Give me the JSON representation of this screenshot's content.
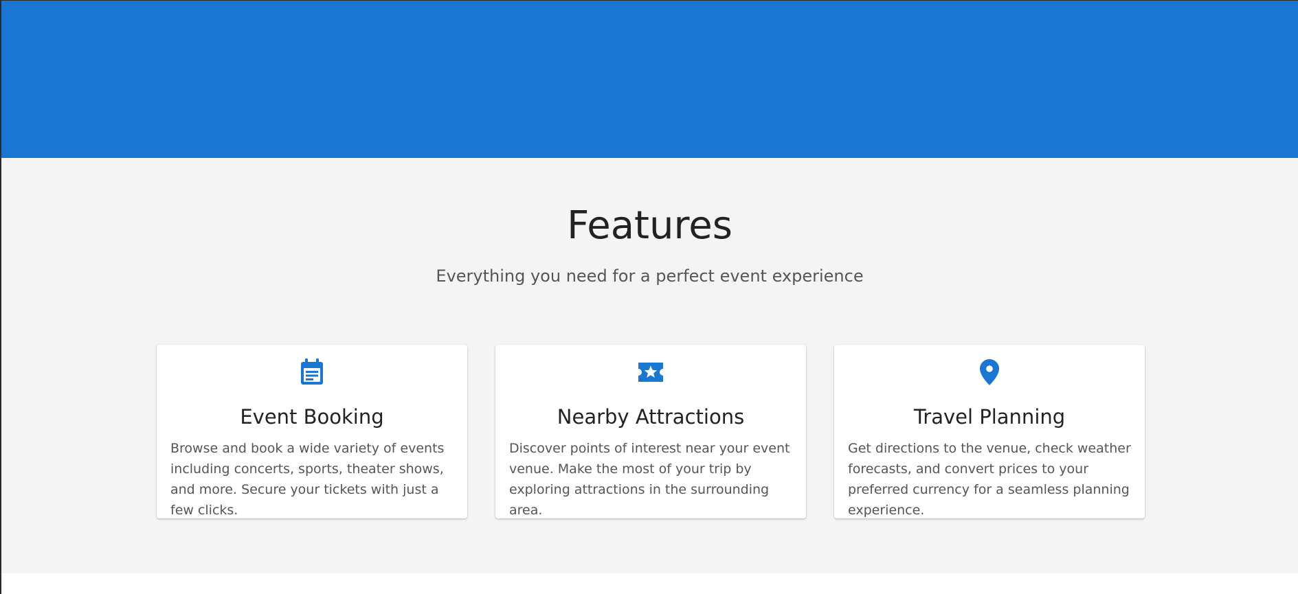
{
  "theme": {
    "primary_color": "#1976d2",
    "section_background": "#f4f4f4"
  },
  "features": {
    "title": "Features",
    "subtitle": "Everything you need for a perfect event experience",
    "cards": [
      {
        "icon": "calendar-icon",
        "title": "Event Booking",
        "description": "Browse and book a wide variety of events including concerts, sports, theater shows, and more. Secure your tickets with just a few clicks."
      },
      {
        "icon": "ticket-star-icon",
        "title": "Nearby Attractions",
        "description": "Discover points of interest near your event venue. Make the most of your trip by exploring attractions in the surrounding area."
      },
      {
        "icon": "map-pin-icon",
        "title": "Travel Planning",
        "description": "Get directions to the venue, check weather forecasts, and convert prices to your preferred currency for a seamless planning experience."
      }
    ]
  }
}
